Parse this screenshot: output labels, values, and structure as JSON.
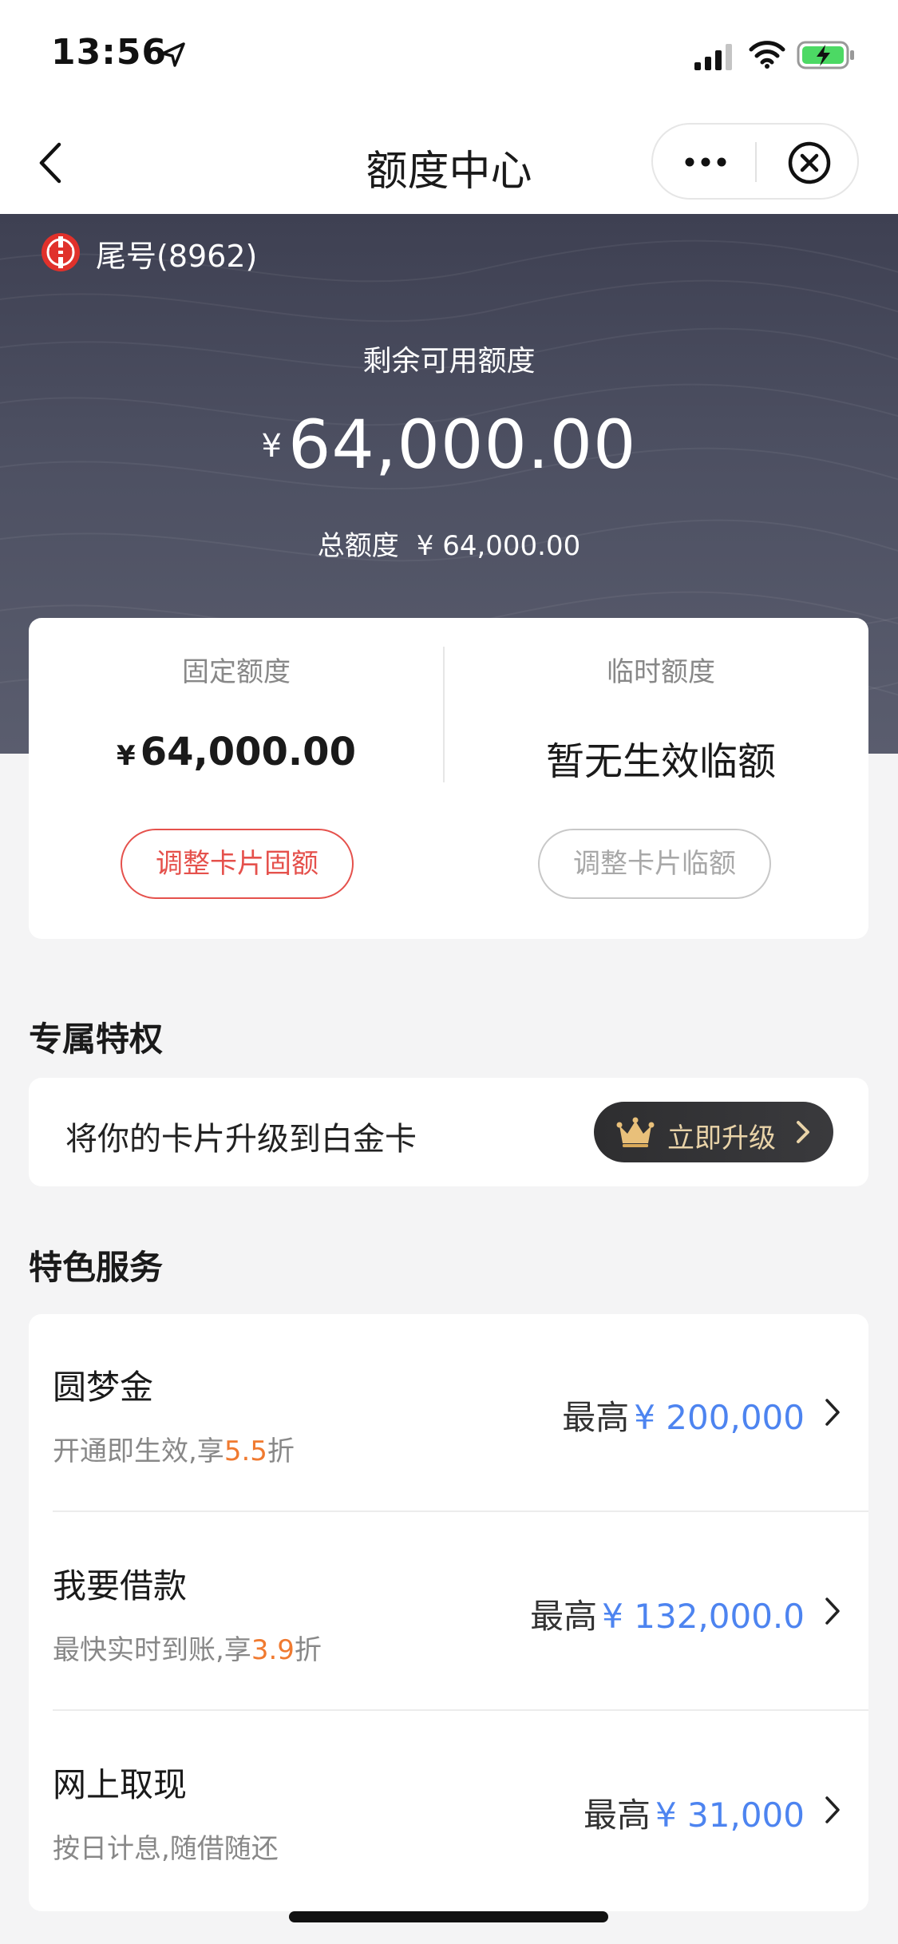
{
  "status_bar": {
    "time": "13:56"
  },
  "nav": {
    "title": "额度中心"
  },
  "hero": {
    "card_tail": "尾号(8962)",
    "available_label": "剩余可用额度",
    "currency": "¥",
    "available_amount": "64,000.00",
    "total_label": "总额度",
    "total_amount": "¥ 64,000.00"
  },
  "quota": {
    "fixed": {
      "label": "固定额度",
      "currency": "¥",
      "value": "64,000.00",
      "button": "调整卡片固额"
    },
    "temp": {
      "label": "临时额度",
      "value": "暂无生效临额",
      "button": "调整卡片临额"
    }
  },
  "privilege": {
    "section_title": "专属特权",
    "text": "将你的卡片升级到白金卡",
    "button": "立即升级"
  },
  "services": {
    "section_title": "特色服务",
    "items": [
      {
        "title": "圆梦金",
        "sub_prefix": "开通即生效,享",
        "sub_highlight": "5.5",
        "sub_suffix": "折",
        "right_prefix": "最高",
        "right_amount": "¥ 200,000"
      },
      {
        "title": "我要借款",
        "sub_prefix": "最快实时到账,享",
        "sub_highlight": "3.9",
        "sub_suffix": "折",
        "right_prefix": "最高",
        "right_amount": "¥ 132,000.0"
      },
      {
        "title": "网上取现",
        "sub_prefix": "按日计息,随借随还",
        "sub_highlight": "",
        "sub_suffix": "",
        "right_prefix": "最高",
        "right_amount": "¥ 31,000"
      }
    ]
  },
  "colors": {
    "accent_red": "#e5514c",
    "link_blue": "#4d84f0",
    "highlight_orange": "#f07a30",
    "hero_bg": "#4d5062",
    "upgrade_gold": "#e9d3a8"
  }
}
